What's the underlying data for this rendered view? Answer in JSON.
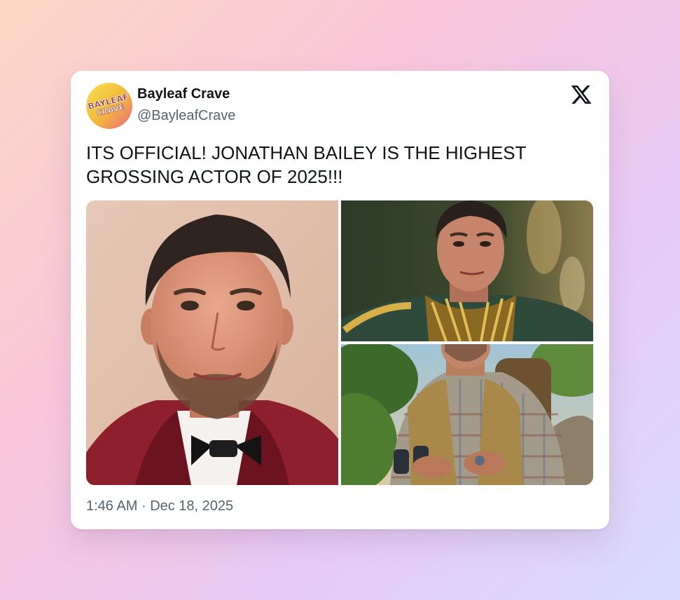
{
  "post": {
    "author": {
      "display_name": "Bayleaf Crave",
      "handle": "@BayleafCrave",
      "avatar_text_line1": "BAYLEAF",
      "avatar_text_line2": "CRAVE"
    },
    "platform_icon": "x-logo-icon",
    "text": "ITS OFFICIAL! JONATHAN BAILEY IS THE HIGHEST GROSSING ACTOR OF 2025!!!",
    "media": [
      {
        "icon": "photo-portrait-tuxedo"
      },
      {
        "icon": "photo-military-uniform"
      },
      {
        "icon": "photo-jungle-explorer"
      }
    ],
    "time": "1:46 AM",
    "separator": "·",
    "date": "Dec 18, 2025"
  },
  "colors": {
    "text_primary": "#0f1419",
    "text_secondary": "#536471",
    "card_background": "#ffffff",
    "avatar_yellow": "#f3c93a",
    "avatar_pink": "#e9677f"
  }
}
